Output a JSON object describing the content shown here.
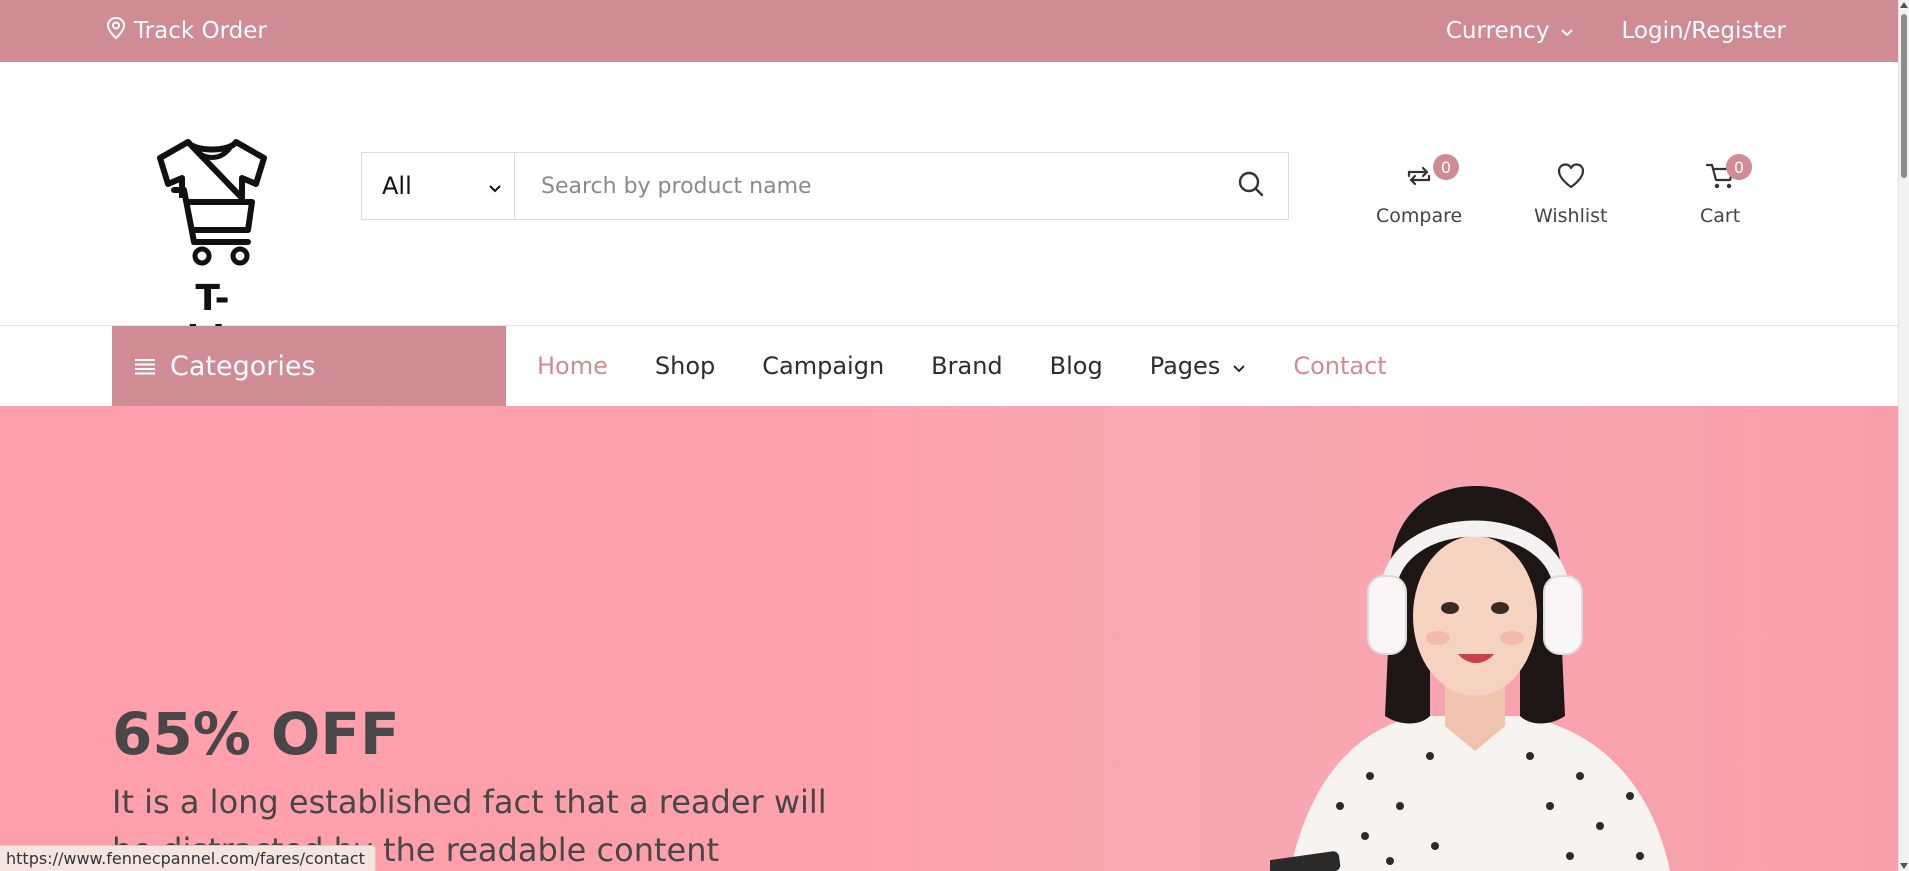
{
  "topbar": {
    "track_order_label": "Track Order",
    "currency_label": "Currency",
    "login_label": "Login/Register",
    "icons": {
      "track": "location-pin-icon",
      "currency_caret": "chevron-down-icon"
    }
  },
  "logo": {
    "text": "T-shirt",
    "icon": "tshirt-cart-logo"
  },
  "search": {
    "category_value": "All",
    "placeholder": "Search by product name",
    "icon": "search-icon"
  },
  "header_icons": {
    "compare": {
      "label": "Compare",
      "count": "0",
      "icon": "compare-arrows-icon"
    },
    "wishlist": {
      "label": "Wishlist",
      "icon": "heart-icon"
    },
    "cart": {
      "label": "Cart",
      "count": "0",
      "icon": "cart-icon"
    }
  },
  "nav": {
    "categories_label": "Categories",
    "items": [
      {
        "label": "Home"
      },
      {
        "label": "Shop"
      },
      {
        "label": "Campaign"
      },
      {
        "label": "Brand"
      },
      {
        "label": "Blog"
      },
      {
        "label": "Pages"
      },
      {
        "label": "Contact"
      }
    ]
  },
  "hero": {
    "discount": "65% OFF",
    "description": "It is a long established fact that a reader will be distracted by the readable content"
  },
  "status_bar": {
    "url": "https://www.fennecpannel.com/fares/contact"
  },
  "colors": {
    "accent": "#cf8c94",
    "hero_bg": "#fea1ad",
    "text_dark": "#474747"
  }
}
